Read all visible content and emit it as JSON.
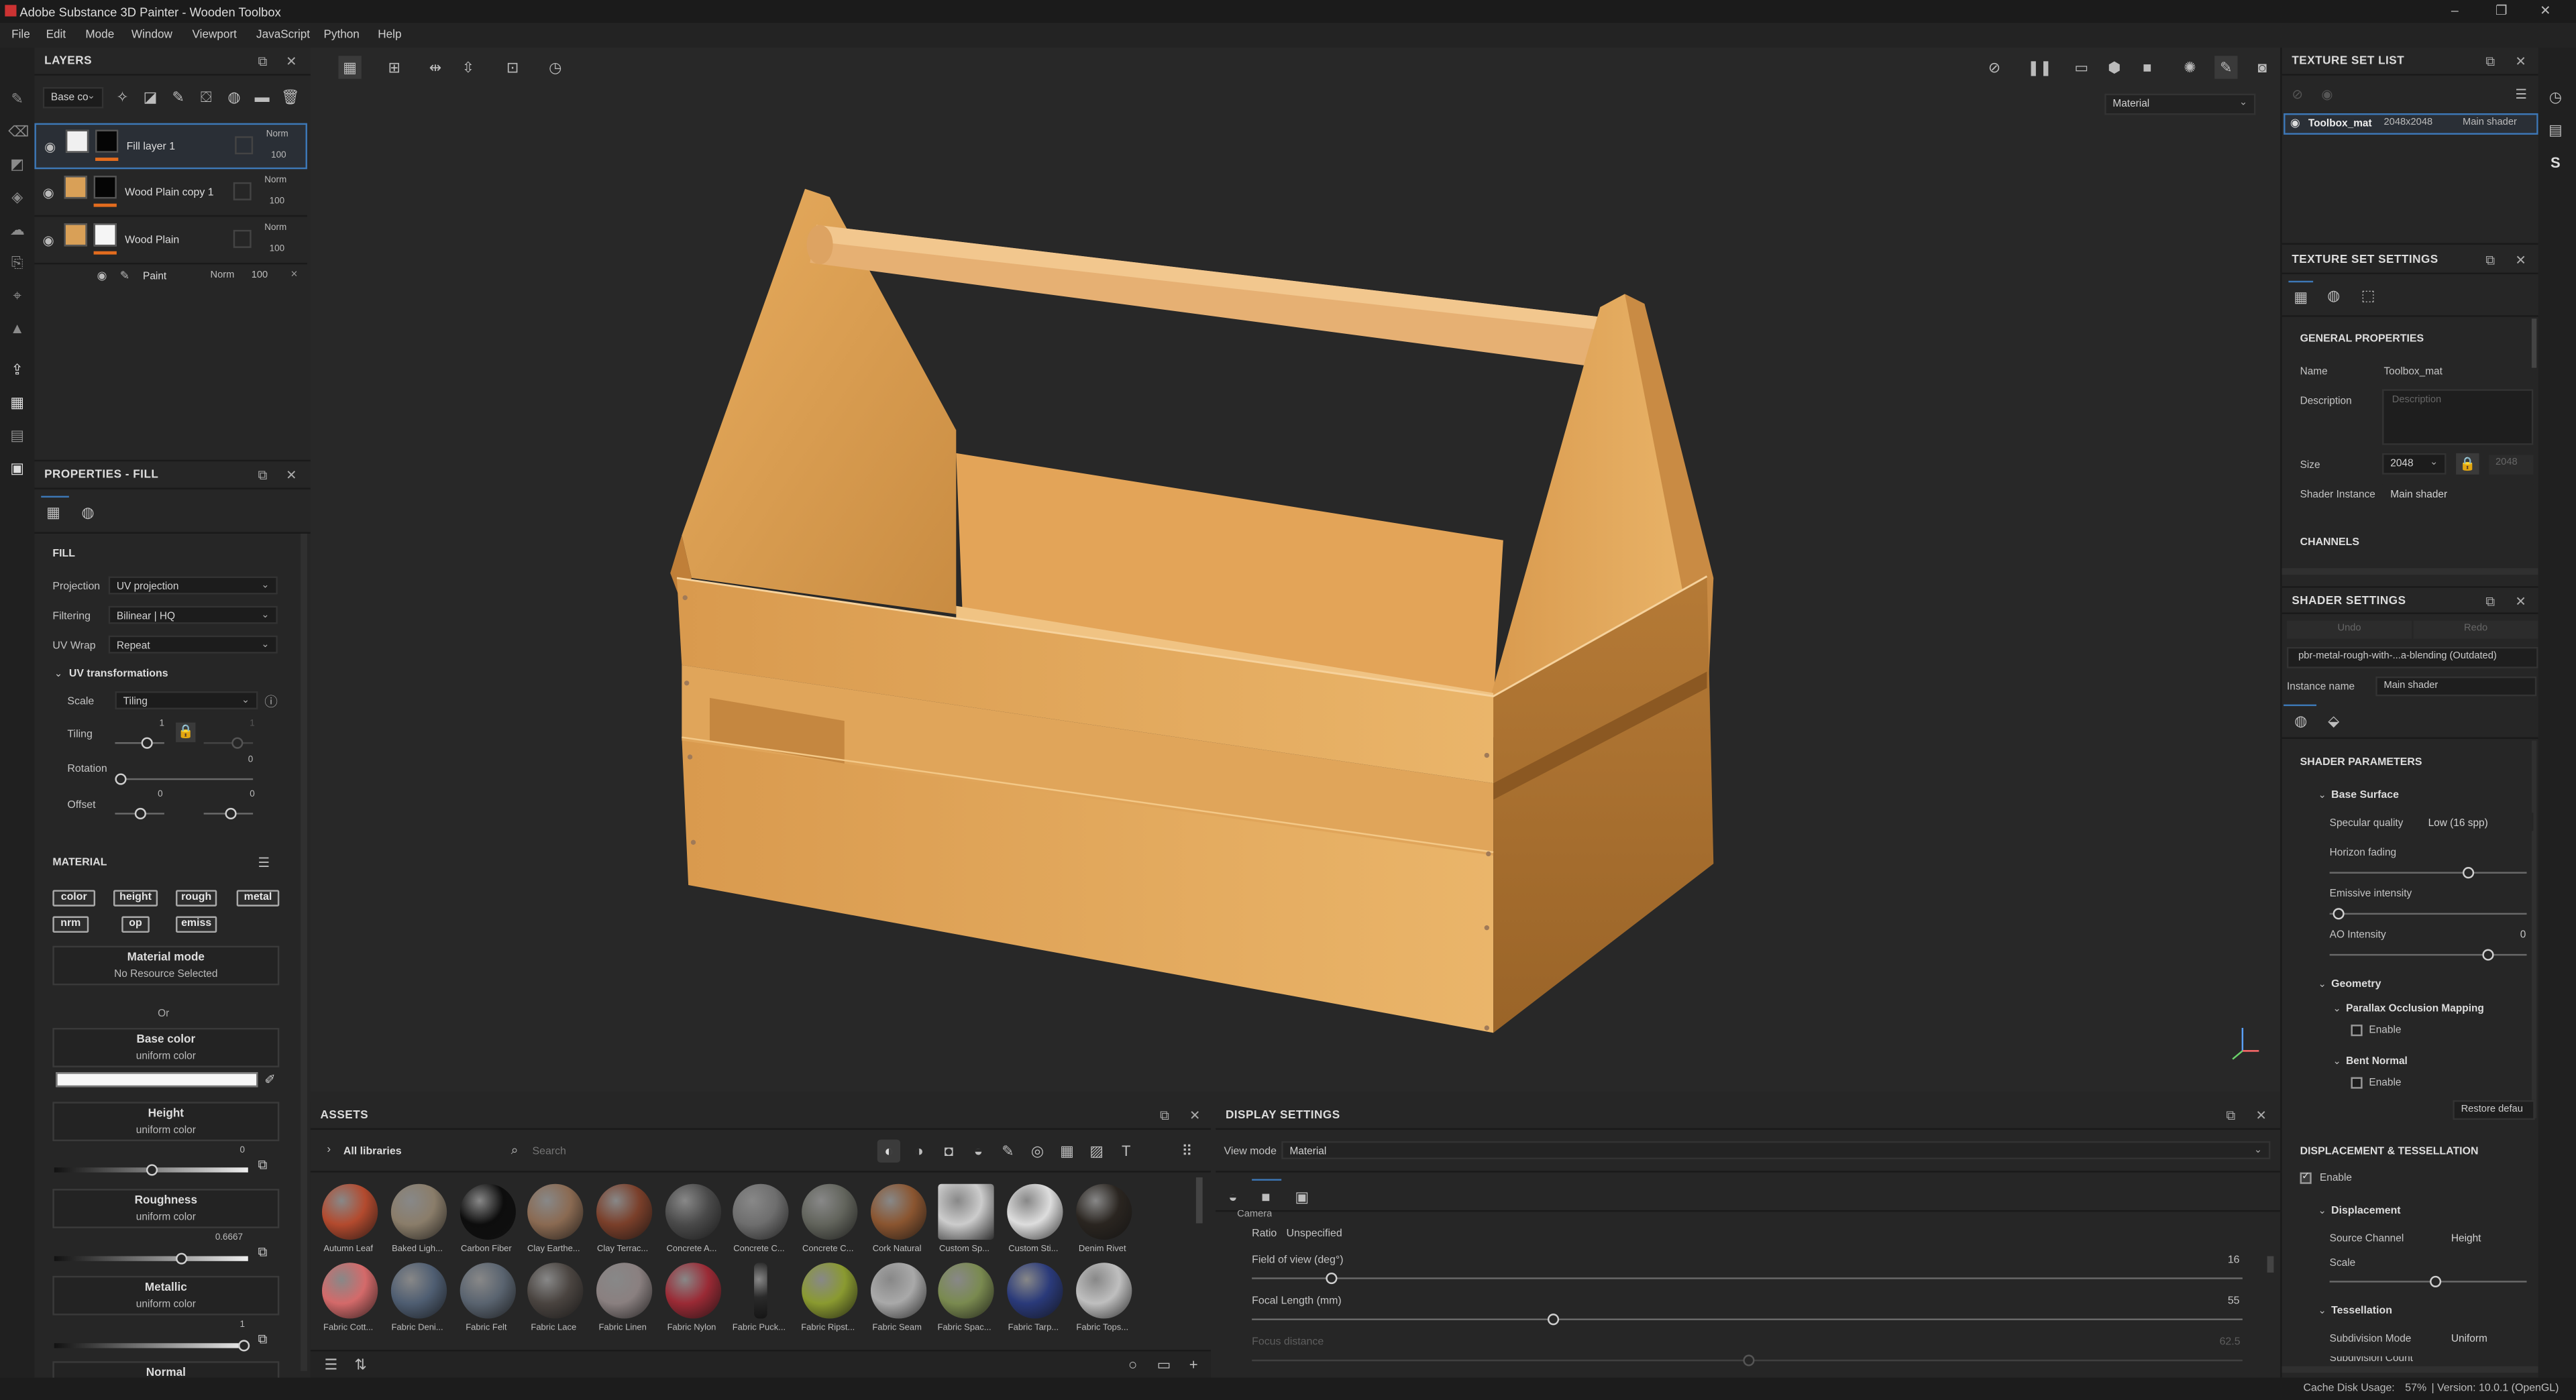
{
  "app": {
    "title": "Adobe Substance 3D Painter - Wooden Toolbox"
  },
  "menu": [
    "File",
    "Edit",
    "Mode",
    "Window",
    "Viewport",
    "JavaScript",
    "Python",
    "Help"
  ],
  "layers": {
    "title": "LAYERS",
    "channel_select": "Base co",
    "rows": [
      {
        "name": "Fill layer 1",
        "blend": "Norm",
        "opacity": "100"
      },
      {
        "name": "Wood Plain copy 1",
        "blend": "Norm",
        "opacity": "100"
      },
      {
        "name": "Wood Plain",
        "blend": "Norm",
        "opacity": "100"
      }
    ],
    "sub": {
      "name": "Paint",
      "blend": "Norm",
      "opacity": "100"
    }
  },
  "properties": {
    "title": "PROPERTIES - FILL",
    "fill_header": "FILL",
    "projection_label": "Projection",
    "projection": "UV projection",
    "filtering_label": "Filtering",
    "filtering": "Bilinear | HQ",
    "uvwrap_label": "UV Wrap",
    "uvwrap": "Repeat",
    "uvtrans": "UV transformations",
    "scale_label": "Scale",
    "scale": "Tiling",
    "tiling_label": "Tiling",
    "tiling_val": "1",
    "tiling_val2": "1",
    "rotation_label": "Rotation",
    "rotation_val": "0",
    "offset_label": "Offset",
    "offset_val1": "0",
    "offset_val2": "0",
    "material_header": "MATERIAL",
    "chips": [
      "color",
      "height",
      "rough",
      "metal",
      "nrm",
      "op",
      "emiss"
    ],
    "material_mode": "Material mode",
    "no_resource": "No Resource Selected",
    "or": "Or",
    "base_color": "Base color",
    "uniform": "uniform color",
    "height": "Height",
    "height_val": "0",
    "roughness": "Roughness",
    "roughness_val": "0.6667",
    "metallic": "Metallic",
    "metallic_val": "1",
    "normal": "Normal"
  },
  "viewport": {
    "mode": "Material"
  },
  "assets": {
    "title": "ASSETS",
    "library": "All libraries",
    "search": "Search",
    "row1": [
      {
        "name": "Autumn Leaf",
        "color": "#b34a2e"
      },
      {
        "name": "Baked Ligh...",
        "color": "#8a7d6a"
      },
      {
        "name": "Carbon Fiber",
        "color": "#0d0d0d"
      },
      {
        "name": "Clay Earthe...",
        "color": "#8a6a52"
      },
      {
        "name": "Clay Terrac...",
        "color": "#7a3f2a"
      },
      {
        "name": "Concrete A...",
        "color": "#4a4a4a"
      },
      {
        "name": "Concrete C...",
        "color": "#6e6e6e"
      },
      {
        "name": "Concrete C...",
        "color": "#62645c"
      },
      {
        "name": "Cork Natural",
        "color": "#8a5530"
      },
      {
        "name": "Custom Sp...",
        "color": "#cccccc"
      },
      {
        "name": "Custom Sti...",
        "color": "#dddddd"
      },
      {
        "name": "Denim Rivet",
        "color": "#2a2520"
      }
    ],
    "row2": [
      {
        "name": "Fabric Cott...",
        "color": "#d46a6a"
      },
      {
        "name": "Fabric Deni...",
        "color": "#4f5e72"
      },
      {
        "name": "Fabric Felt",
        "color": "#5a6470"
      },
      {
        "name": "Fabric Lace",
        "color": "#4a4440"
      },
      {
        "name": "Fabric Linen",
        "color": "#8a8080"
      },
      {
        "name": "Fabric Nylon",
        "color": "#9a2a35"
      },
      {
        "name": "Fabric Puck...",
        "color": "#2a2a2a"
      },
      {
        "name": "Fabric Ripst...",
        "color": "#8a9a30"
      },
      {
        "name": "Fabric Seam",
        "color": "#a9a9a9"
      },
      {
        "name": "Fabric Spac...",
        "color": "#7a8a50"
      },
      {
        "name": "Fabric Tarp...",
        "color": "#2a3a7a"
      },
      {
        "name": "Fabric Tops...",
        "color": "#bfbfbf"
      }
    ]
  },
  "display": {
    "title": "DISPLAY SETTINGS",
    "viewmode_label": "View mode",
    "viewmode": "Material",
    "camera": "Camera",
    "ratio_label": "Ratio",
    "ratio": "Unspecified",
    "fov_label": "Field of view (deg°)",
    "fov": "16",
    "focal_label": "Focal Length (mm)",
    "focal": "55",
    "focus_label": "Focus distance",
    "focus": "62.5"
  },
  "texset_list": {
    "title": "TEXTURE SET LIST",
    "name": "Toolbox_mat",
    "res": "2048x2048",
    "shader": "Main shader"
  },
  "texset_settings": {
    "title": "TEXTURE SET SETTINGS",
    "general": "GENERAL PROPERTIES",
    "name_label": "Name",
    "name": "Toolbox_mat",
    "desc_label": "Description",
    "desc_placeholder": "Description",
    "size_label": "Size",
    "size": "2048",
    "size2": "2048",
    "shader_label": "Shader Instance",
    "shader": "Main shader",
    "channels": "CHANNELS"
  },
  "shader_settings": {
    "title": "SHADER SETTINGS",
    "undo": "Undo",
    "redo": "Redo",
    "shader_name": "pbr-metal-rough-with-...a-blending (Outdated)",
    "instance_label": "Instance name",
    "instance": "Main shader",
    "params": "SHADER PARAMETERS",
    "base_surface": "Base Surface",
    "spec_label": "Specular quality",
    "spec": "Low (16 spp)",
    "horizon": "Horizon fading",
    "emissive": "Emissive intensity",
    "ao": "AO Intensity",
    "ao_val": "0",
    "geometry": "Geometry",
    "pom": "Parallax Occlusion Mapping",
    "enable": "Enable",
    "bent": "Bent Normal",
    "restore": "Restore defau",
    "disp_tess": "DISPLACEMENT & TESSELLATION",
    "displacement": "Displacement",
    "source_label": "Source Channel",
    "source": "Height",
    "scale_label": "Scale",
    "tess": "Tessellation",
    "subdiv_label": "Subdivision Mode",
    "subdiv": "Uniform",
    "subdiv_count": "Subdivision Count"
  },
  "status": {
    "cache": "Cache Disk Usage:",
    "cache_val": "57%",
    "version": "| Version: 10.0.1 (OpenGL)"
  },
  "colors": {
    "accent": "#e36c1e",
    "wood": "#e0a85a",
    "panel": "#262626"
  }
}
